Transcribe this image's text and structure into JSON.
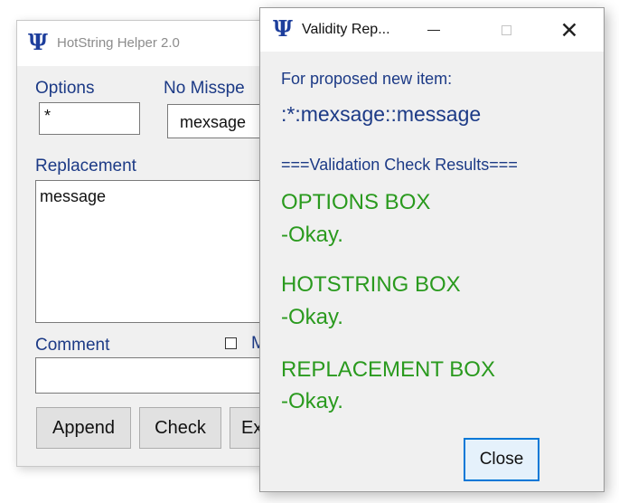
{
  "back_window": {
    "title": "HotString Helper 2.0",
    "options_label": "Options",
    "options_value": "*",
    "misspell_label": "No Misspe",
    "misspell_value": "mexsage",
    "replacement_label": "Replacement",
    "replacement_value": "message",
    "comment_label": "Comment",
    "comment_value": "",
    "checkbox_label": "M",
    "buttons": {
      "append": "Append",
      "check": "Check",
      "exit_partial": "Ex"
    }
  },
  "front_window": {
    "title": "Validity Rep...",
    "proposed_label": "For proposed new item:",
    "proposed_item": ":*:mexsage::message",
    "results_header": "===Validation Check Results===",
    "sections": [
      {
        "heading": "OPTIONS BOX",
        "result": "-Okay."
      },
      {
        "heading": "HOTSTRING BOX",
        "result": "-Okay."
      },
      {
        "heading": "REPLACEMENT BOX",
        "result": "-Okay."
      }
    ],
    "close_label": "Close"
  },
  "colors": {
    "label_blue": "#1c3a86",
    "result_green": "#2a9a1e",
    "icon_blue": "#1d3e9c",
    "focus_blue": "#0078d7"
  },
  "icons": {
    "app_icon": "psi-icon",
    "minimize": "minimize-icon",
    "maximize": "maximize-icon",
    "close": "close-icon"
  }
}
